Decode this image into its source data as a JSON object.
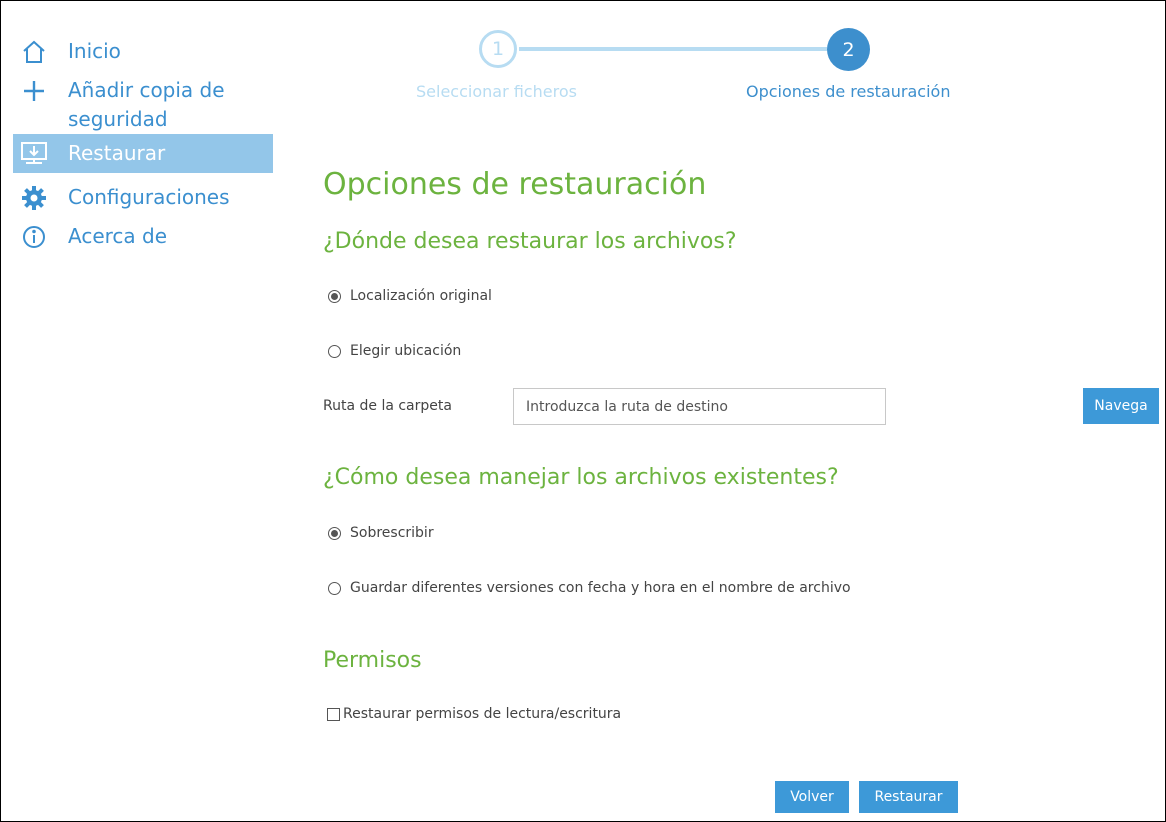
{
  "sidebar": {
    "items": [
      {
        "label": "Inicio",
        "icon": "home-icon"
      },
      {
        "label": "Añadir copia de seguridad",
        "icon": "plus-icon"
      },
      {
        "label": "Restaurar",
        "icon": "restore-icon"
      },
      {
        "label": "Configuraciones",
        "icon": "gear-icon"
      },
      {
        "label": "Acerca de",
        "icon": "info-icon"
      }
    ]
  },
  "stepper": {
    "steps": [
      {
        "number": "1",
        "label": "Seleccionar ficheros"
      },
      {
        "number": "2",
        "label": "Opciones de restauración"
      }
    ]
  },
  "main": {
    "title": "Opciones de restauración",
    "location": {
      "heading": "¿Dónde desea restaurar los archivos?",
      "option_original": "Localización original",
      "option_choose": "Elegir ubicación",
      "path_label": "Ruta de la carpeta",
      "path_placeholder": "Introduzca la ruta de destino",
      "browse_label": "Navega"
    },
    "existing": {
      "heading": "¿Cómo desea manejar los archivos existentes?",
      "option_overwrite": "Sobrescribir",
      "option_versions": "Guardar diferentes versiones con fecha y hora en el nombre de archivo"
    },
    "permissions": {
      "heading": "Permisos",
      "checkbox_label": "Restaurar permisos de lectura/escritura"
    },
    "footer": {
      "back_label": "Volver",
      "restore_label": "Restaurar"
    }
  },
  "colors": {
    "accent_blue": "#3d8fcd",
    "active_bg": "#93c6e9",
    "heading_green": "#6cb33f",
    "inactive_step": "#b7dcf2"
  }
}
